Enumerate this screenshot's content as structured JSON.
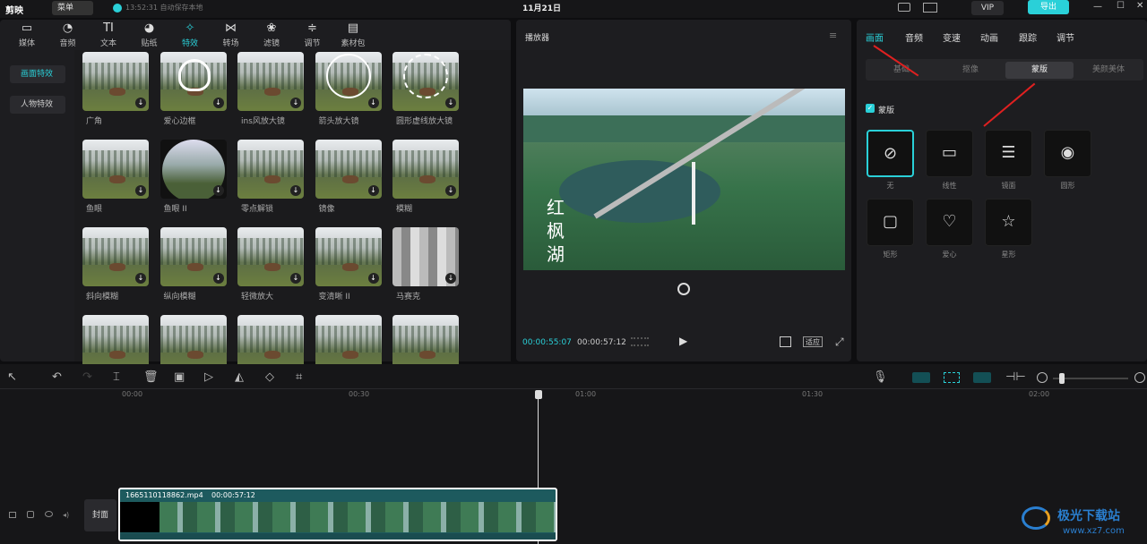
{
  "app": {
    "logo": "剪映",
    "menu": "菜单",
    "autosave": "13:52:31 自动保存本地",
    "project_title": "11月21日",
    "vip": "VIP",
    "export": "导出"
  },
  "toolbar": [
    {
      "label": "媒体",
      "icon": "media-icon"
    },
    {
      "label": "音频",
      "icon": "audio-icon"
    },
    {
      "label": "文本",
      "icon": "text-icon"
    },
    {
      "label": "贴纸",
      "icon": "sticker-icon"
    },
    {
      "label": "特效",
      "icon": "effects-icon",
      "active": true
    },
    {
      "label": "转场",
      "icon": "transition-icon"
    },
    {
      "label": "滤镜",
      "icon": "filter-icon"
    },
    {
      "label": "调节",
      "icon": "adjust-icon"
    },
    {
      "label": "素材包",
      "icon": "package-icon"
    }
  ],
  "sidebar": [
    {
      "label": "画面特效",
      "active": true
    },
    {
      "label": "人物特效"
    }
  ],
  "effects": [
    [
      "广角",
      "爱心边框",
      "ins风放大镜",
      "箭头放大镜",
      "圆形虚线放大镜"
    ],
    [
      "鱼眼",
      "鱼眼 II",
      "零点解锁",
      "镜像",
      "模糊"
    ],
    [
      "斜向模糊",
      "纵向模糊",
      "轻微放大",
      "变清晰 II",
      "马赛克"
    ],
    [
      "",
      "",
      "",
      "",
      ""
    ]
  ],
  "player": {
    "title": "播放器",
    "current": "00:00:55:07",
    "total": "00:00:57:12",
    "fit": "适应",
    "overlay": "红 枫 湖"
  },
  "inspector": {
    "tabs": [
      "画面",
      "音频",
      "变速",
      "动画",
      "跟踪",
      "调节"
    ],
    "subtabs": [
      "基础",
      "抠像",
      "蒙版",
      "美颜美体"
    ],
    "mask_checkbox": "蒙版",
    "masks": [
      "无",
      "线性",
      "镜面",
      "圆形",
      "矩形",
      "爱心",
      "星形"
    ]
  },
  "timeline": {
    "ticks": [
      "00:00",
      "00:30",
      "01:00",
      "01:30",
      "02:00"
    ],
    "clip_name": "1665110118862.mp4",
    "clip_duration": "00:00:57:12",
    "cover": "封面"
  },
  "watermark": {
    "brand": "极光下载站",
    "url": "www.xz7.com"
  },
  "colors": {
    "accent": "#2ad0d8",
    "arrow": "#e02020"
  }
}
